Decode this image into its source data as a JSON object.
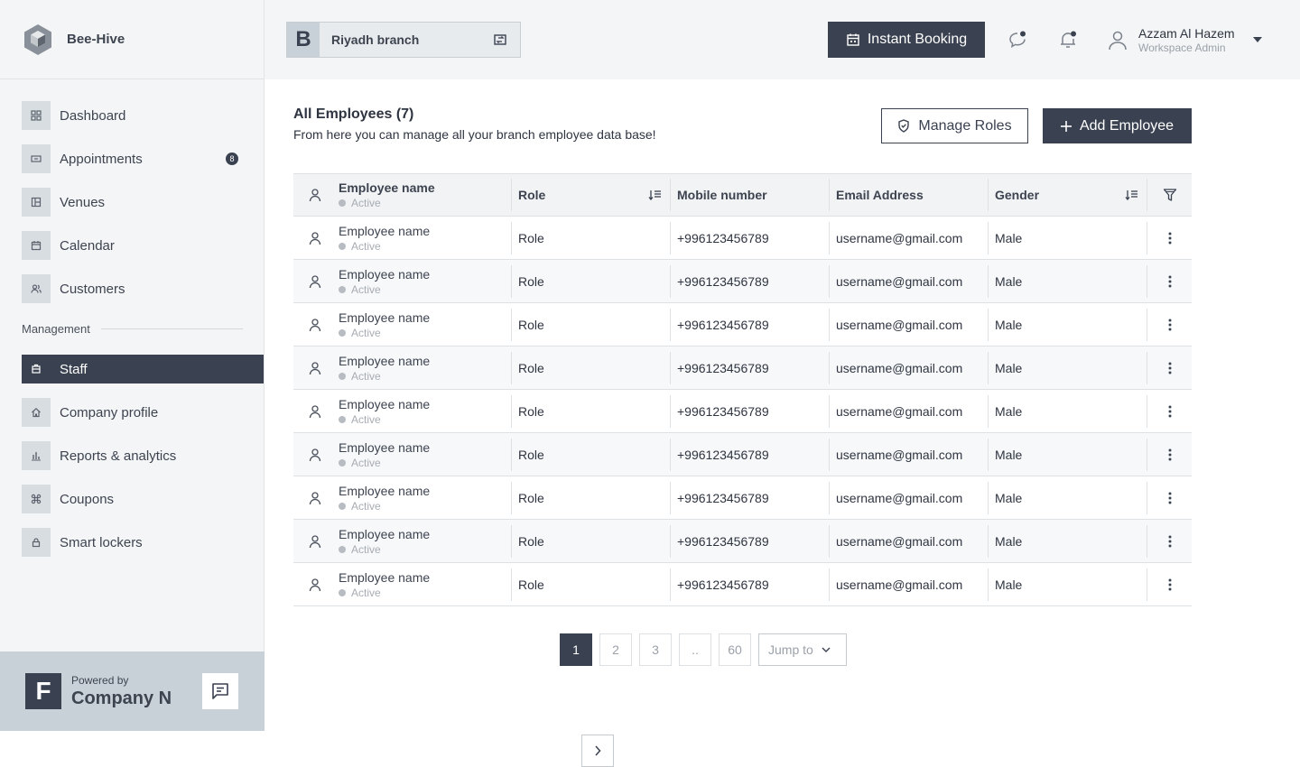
{
  "brand": {
    "name": "Bee-Hive"
  },
  "sidebar": {
    "items": [
      {
        "label": "Dashboard",
        "icon": "grid-icon"
      },
      {
        "label": "Appointments",
        "icon": "ticket-icon",
        "badge": "8"
      },
      {
        "label": "Venues",
        "icon": "building-icon"
      },
      {
        "label": "Calendar",
        "icon": "calendar-icon"
      },
      {
        "label": "Customers",
        "icon": "users-icon"
      }
    ],
    "section_label": "Management",
    "mgmt_items": [
      {
        "label": "Staff",
        "icon": "staff-icon",
        "active": true
      },
      {
        "label": "Company profile",
        "icon": "home-icon"
      },
      {
        "label": "Reports & analytics",
        "icon": "chart-icon"
      },
      {
        "label": "Coupons",
        "icon": "coupon-icon"
      },
      {
        "label": "Smart lockers",
        "icon": "lock-icon"
      }
    ],
    "footer": {
      "logo_letter": "F",
      "powered": "Powered by",
      "company": "Company N"
    }
  },
  "topbar": {
    "branch_letter": "B",
    "branch_name": "Riyadh branch",
    "instant_booking": "Instant Booking",
    "user_name": "Azzam Al Hazem",
    "user_role": "Workspace Admin"
  },
  "main": {
    "title": "All Employees (7)",
    "subtitle": "From here you can manage all your branch employee data base!",
    "manage_roles": "Manage Roles",
    "add_employee": "Add Employee"
  },
  "table": {
    "headers": {
      "name": "Employee name",
      "status": "Active",
      "role": "Role",
      "mobile": "Mobile number",
      "email": "Email Address",
      "gender": "Gender"
    },
    "rows": [
      {
        "name": "Employee name",
        "status": "Active",
        "role": "Role",
        "mobile": "+996123456789",
        "email": "username@gmail.com",
        "gender": "Male"
      },
      {
        "name": "Employee name",
        "status": "Active",
        "role": "Role",
        "mobile": "+996123456789",
        "email": "username@gmail.com",
        "gender": "Male"
      },
      {
        "name": "Employee name",
        "status": "Active",
        "role": "Role",
        "mobile": "+996123456789",
        "email": "username@gmail.com",
        "gender": "Male"
      },
      {
        "name": "Employee name",
        "status": "Active",
        "role": "Role",
        "mobile": "+996123456789",
        "email": "username@gmail.com",
        "gender": "Male"
      },
      {
        "name": "Employee name",
        "status": "Active",
        "role": "Role",
        "mobile": "+996123456789",
        "email": "username@gmail.com",
        "gender": "Male"
      },
      {
        "name": "Employee name",
        "status": "Active",
        "role": "Role",
        "mobile": "+996123456789",
        "email": "username@gmail.com",
        "gender": "Male"
      },
      {
        "name": "Employee name",
        "status": "Active",
        "role": "Role",
        "mobile": "+996123456789",
        "email": "username@gmail.com",
        "gender": "Male"
      },
      {
        "name": "Employee name",
        "status": "Active",
        "role": "Role",
        "mobile": "+996123456789",
        "email": "username@gmail.com",
        "gender": "Male"
      },
      {
        "name": "Employee name",
        "status": "Active",
        "role": "Role",
        "mobile": "+996123456789",
        "email": "username@gmail.com",
        "gender": "Male"
      }
    ]
  },
  "pagination": {
    "pages": [
      "1",
      "2",
      "3",
      "..",
      "60"
    ],
    "current": "1",
    "jump": "Jump to"
  },
  "colors": {
    "primary": "#3a4150",
    "sidebar_bg": "#f4f5f6",
    "footer_bg": "#c9d1d8"
  }
}
